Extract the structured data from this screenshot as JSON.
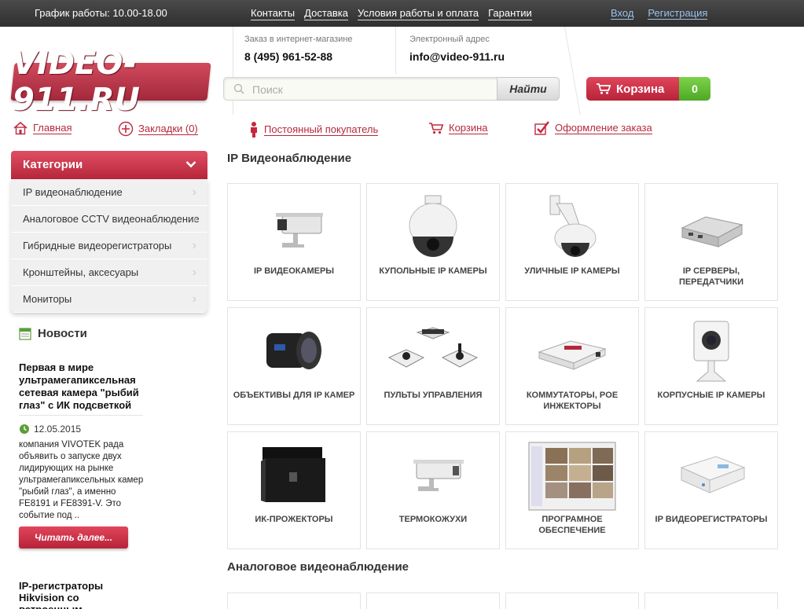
{
  "topbar": {
    "hours": "График работы: 10.00-18.00",
    "links": [
      "Контакты",
      "Доставка",
      "Условия работы и оплата",
      "Гарантии"
    ],
    "login": "Вход",
    "register": "Регистрация"
  },
  "header": {
    "logo": "VIDEO-911.RU",
    "phone_label": "Заказ в интернет-магазине",
    "phone": "8 (495) 961-52-88",
    "email_label": "Электронный адрес",
    "email": "info@video-911.ru",
    "search_placeholder": "Поиск",
    "search_button": "Найти",
    "cart_label": "Корзина",
    "cart_count": "0"
  },
  "nav": [
    {
      "label": "Главная",
      "icon": "home-icon"
    },
    {
      "label": "Закладки (0)",
      "icon": "plus-circle-icon"
    },
    {
      "label": "Постоянный покупатель",
      "icon": "person-icon"
    },
    {
      "label": "Корзина",
      "icon": "cart-icon"
    },
    {
      "label": "Оформление заказа",
      "icon": "checkmark-icon"
    }
  ],
  "sidebar": {
    "title": "Категории",
    "items": [
      "IP видеонаблюдение",
      "Аналоговое CCTV видеонаблюдение",
      "Гибридные видеорегистраторы",
      "Кронштейны, аксесуары",
      "Мониторы"
    ],
    "news_title": "Новости",
    "news": [
      {
        "title": "Первая в мире ультрамегапиксельная сетевая камера \"рыбий глаз\" с ИК подсветкой",
        "date": "12.05.2015",
        "body": "компания VIVOTEK рада объявить о запуске двух лидирующих на рынке ультрамегапиксельных камер \"рыбий глаз\", а именно FE8191 и FE8391-V. Это событие под ..",
        "more": "Читать далее..."
      },
      {
        "title": "IP-регистраторы Hikvision со встроенным"
      }
    ]
  },
  "main": {
    "section1": "IP Видеонаблюдение",
    "section2": "Аналоговое видеонаблюдение",
    "cards": [
      {
        "label": "IP видеокамеры",
        "icon": "box-camera-icon"
      },
      {
        "label": "Купольные IP камеры",
        "icon": "dome-camera-icon"
      },
      {
        "label": "Уличные IP камеры",
        "icon": "outdoor-dome-camera-icon"
      },
      {
        "label": "IP серверы, передатчики",
        "icon": "video-server-icon"
      },
      {
        "label": "Объективы для IP камер",
        "icon": "lens-icon"
      },
      {
        "label": "Пульты управления",
        "icon": "joystick-controller-icon"
      },
      {
        "label": "Коммутаторы, POE инжекторы",
        "icon": "poe-injector-icon"
      },
      {
        "label": "Корпусные IP камеры",
        "icon": "cube-camera-icon"
      },
      {
        "label": "ИК-прожекторы",
        "icon": "ir-illuminator-icon"
      },
      {
        "label": "Термокожухи",
        "icon": "housing-camera-icon"
      },
      {
        "label": "Програмное обеспечение",
        "icon": "software-screen-icon"
      },
      {
        "label": "IP видеорегистраторы",
        "icon": "nvr-icon"
      }
    ]
  },
  "colors": {
    "accent": "#c2293f",
    "topbar": "#3a3a3a",
    "cart_count_bg": "#5cb82e",
    "link_blue": "#9dc3ea"
  }
}
